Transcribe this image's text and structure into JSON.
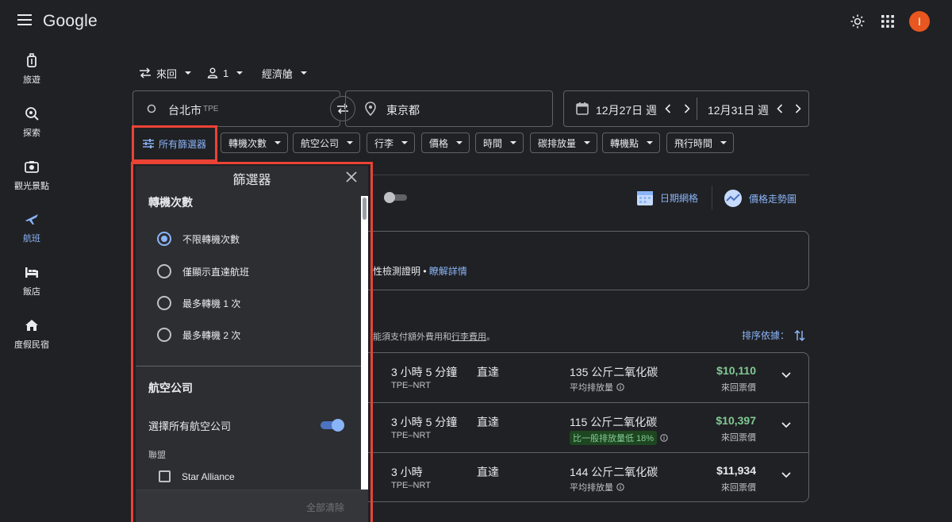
{
  "header": {
    "logo": "Google",
    "avatar_letter": "I"
  },
  "sidebar": {
    "items": [
      {
        "label": "旅遊"
      },
      {
        "label": "探索"
      },
      {
        "label": "觀光景點"
      },
      {
        "label": "航班"
      },
      {
        "label": "飯店"
      },
      {
        "label": "度假民宿"
      }
    ]
  },
  "trip_options": {
    "trip_type": "來回",
    "passengers": "1",
    "cabin": "經濟艙"
  },
  "search": {
    "origin": "台北市",
    "origin_code": "TPE",
    "destination": "東京都",
    "depart_date": "12月27日 週",
    "return_date": "12月31日 週"
  },
  "filters_bar": {
    "all_filters": "所有篩選器",
    "chips": [
      "轉機次數",
      "航空公司",
      "行李",
      "價格",
      "時間",
      "碳排放量",
      "轉機點",
      "飛行時間"
    ]
  },
  "background": {
    "date_grid": "日期網格",
    "price_graph": "價格走勢圖",
    "notice_text": "性檢測證明 •",
    "notice_link": "瞭解詳情",
    "fee_text_prefix": "能須支付額外費用和",
    "fee_link": "行李費用",
    "fee_text_suffix": "。",
    "sort_label": "排序依據："
  },
  "results": [
    {
      "duration": "3 小時 5 分鐘",
      "route": "TPE–NRT",
      "stops": "直達",
      "co2": "135 公斤二氧化碳",
      "co2_note": "平均排放量",
      "co2_badge": "",
      "price": "$10,110",
      "price_green": true,
      "price_note": "來回票價"
    },
    {
      "duration": "3 小時 5 分鐘",
      "route": "TPE–NRT",
      "stops": "直達",
      "co2": "115 公斤二氧化碳",
      "co2_note": "",
      "co2_badge": "比一般排放量低 18%",
      "price": "$10,397",
      "price_green": true,
      "price_note": "來回票價"
    },
    {
      "duration": "3 小時",
      "route": "TPE–NRT",
      "stops": "直達",
      "co2": "144 公斤二氧化碳",
      "co2_note": "平均排放量",
      "co2_badge": "",
      "price": "$11,934",
      "price_green": false,
      "price_note": "來回票價"
    }
  ],
  "filter_panel": {
    "title": "篩選器",
    "stops_section": {
      "title": "轉機次數",
      "options": [
        "不限轉機次數",
        "僅顯示直達航班",
        "最多轉機 1 次",
        "最多轉機 2 次"
      ],
      "selected_index": 0
    },
    "airlines_section": {
      "title": "航空公司",
      "select_all_label": "選擇所有航空公司",
      "select_all_on": true,
      "alliance_label": "聯盟",
      "alliances": [
        "Star Alliance"
      ]
    },
    "clear_all": "全部清除"
  },
  "colors": {
    "background": "#202124",
    "accent": "#8ab4f8",
    "price_green": "#81c995",
    "highlight_box": "#ea4335",
    "avatar": "#e8571f"
  }
}
